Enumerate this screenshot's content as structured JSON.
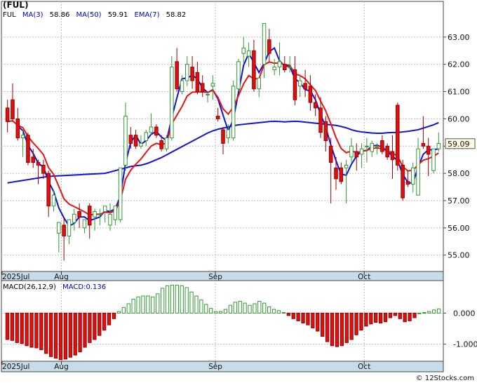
{
  "chart_data": [
    {
      "type": "candlestick",
      "title": "(FUL)",
      "legend": [
        {
          "label": "FUL",
          "color": "#000000"
        },
        {
          "label": "MA(3)",
          "color": "#0000cc"
        },
        {
          "label": "58.86",
          "color": "#000000"
        },
        {
          "label": "MA(50)",
          "color": "#0000cc"
        },
        {
          "label": "59.91",
          "color": "#000000"
        },
        {
          "label": "EMA(7)",
          "color": "#0000cc"
        },
        {
          "label": "58.82",
          "color": "#000000"
        }
      ],
      "last_price_label": "59.09",
      "ylim": [
        54.4,
        64.0
      ],
      "yticks": [
        {
          "v": 55,
          "label": "55.00"
        },
        {
          "v": 56,
          "label": "56.00"
        },
        {
          "v": 57,
          "label": "57.00"
        },
        {
          "v": 58,
          "label": "58.00"
        },
        {
          "v": 59,
          "label": "59.00"
        },
        {
          "v": 60,
          "label": "60.00"
        },
        {
          "v": 61,
          "label": "61.00"
        },
        {
          "v": 62,
          "label": "62.00"
        },
        {
          "v": 63,
          "label": "63.00"
        }
      ],
      "x_labels": [
        {
          "i": 0,
          "label": "2025Jul"
        },
        {
          "i": 11,
          "label": "Aug"
        },
        {
          "i": 41,
          "label": "Sep"
        },
        {
          "i": 70,
          "label": "Oct"
        }
      ],
      "colors": {
        "up_fill": "#ffffff",
        "up_stroke": "#339933",
        "down_fill": "#dd1111",
        "down_stroke": "#990000",
        "ma": "#1111dd",
        "ema": "#ee1111"
      },
      "ohlc": [
        [
          60.4,
          60.7,
          59.5,
          59.9
        ],
        [
          60.7,
          61.3,
          59.9,
          60.0
        ],
        [
          60.0,
          60.4,
          59.2,
          59.3
        ],
        [
          59.3,
          59.6,
          58.6,
          59.4
        ],
        [
          59.4,
          59.5,
          58.3,
          58.4
        ],
        [
          58.6,
          58.9,
          58.2,
          58.4
        ],
        [
          58.4,
          58.5,
          57.6,
          58.3
        ],
        [
          58.3,
          58.5,
          57.8,
          58.0
        ],
        [
          58.0,
          58.1,
          56.4,
          56.8
        ],
        [
          56.8,
          57.4,
          56.6,
          57.2
        ],
        [
          55.8,
          56.1,
          55.1,
          56.2
        ],
        [
          56.1,
          56.4,
          54.8,
          55.7
        ],
        [
          55.7,
          56.2,
          55.4,
          56.3
        ],
        [
          56.2,
          56.7,
          55.9,
          56.5
        ],
        [
          56.6,
          56.9,
          56.0,
          56.4
        ],
        [
          56.0,
          56.3,
          55.8,
          56.3
        ],
        [
          56.8,
          56.9,
          55.6,
          56.1
        ],
        [
          56.4,
          56.7,
          55.9,
          56.6
        ],
        [
          56.5,
          56.7,
          56.1,
          56.5
        ],
        [
          56.6,
          56.7,
          56.2,
          56.8
        ],
        [
          56.1,
          56.9,
          55.9,
          56.5
        ],
        [
          56.3,
          56.8,
          56.1,
          56.8
        ],
        [
          56.3,
          58.1,
          56.2,
          58.2
        ],
        [
          58.3,
          60.6,
          58.1,
          60.1
        ],
        [
          59.4,
          59.7,
          58.9,
          59.1
        ],
        [
          59.4,
          59.6,
          58.9,
          59.0
        ],
        [
          59.0,
          59.4,
          58.9,
          59.1
        ],
        [
          59.2,
          59.6,
          59.0,
          59.5
        ],
        [
          59.5,
          60.2,
          59.4,
          59.7
        ],
        [
          59.7,
          59.8,
          59.3,
          59.4
        ],
        [
          59.2,
          59.4,
          58.8,
          58.9
        ],
        [
          58.9,
          59.4,
          58.8,
          59.3
        ],
        [
          59.3,
          62.3,
          59.2,
          61.9
        ],
        [
          62.1,
          62.6,
          61.0,
          61.1
        ],
        [
          61.0,
          61.6,
          60.9,
          61.4
        ],
        [
          61.4,
          62.3,
          61.2,
          62.0
        ],
        [
          61.9,
          62.3,
          61.1,
          61.4
        ],
        [
          61.7,
          62.1,
          60.9,
          61.0
        ],
        [
          61.3,
          61.6,
          60.8,
          61.0
        ],
        [
          60.9,
          61.0,
          60.6,
          60.9
        ],
        [
          61.2,
          61.6,
          60.7,
          61.3
        ],
        [
          60.1,
          60.4,
          59.9,
          60.0
        ],
        [
          59.6,
          59.7,
          58.7,
          59.1
        ],
        [
          59.3,
          59.8,
          59.1,
          59.6
        ],
        [
          59.3,
          61.4,
          59.2,
          61.2
        ],
        [
          61.1,
          62.2,
          61.0,
          62.1
        ],
        [
          62.4,
          63.0,
          62.0,
          62.6
        ],
        [
          62.3,
          62.8,
          61.9,
          62.5
        ],
        [
          62.5,
          62.9,
          61.0,
          61.1
        ],
        [
          61.1,
          61.4,
          60.8,
          61.5
        ],
        [
          62.0,
          63.3,
          61.5,
          63.5
        ],
        [
          62.9,
          63.3,
          62.1,
          62.4
        ],
        [
          61.8,
          62.2,
          61.6,
          61.9
        ],
        [
          61.9,
          62.8,
          61.6,
          62.1
        ],
        [
          62.0,
          62.3,
          61.7,
          61.8
        ],
        [
          61.9,
          62.3,
          61.7,
          61.9
        ],
        [
          61.8,
          62.3,
          60.5,
          60.7
        ],
        [
          61.2,
          61.6,
          60.8,
          61.4
        ],
        [
          61.3,
          61.8,
          60.8,
          61.1
        ],
        [
          61.2,
          61.6,
          60.3,
          60.6
        ],
        [
          60.6,
          60.9,
          60.1,
          60.4
        ],
        [
          60.4,
          60.8,
          59.3,
          59.5
        ],
        [
          59.9,
          60.1,
          58.8,
          59.2
        ],
        [
          59.0,
          59.3,
          56.9,
          58.4
        ],
        [
          58.2,
          58.6,
          57.4,
          57.8
        ],
        [
          58.2,
          58.4,
          57.6,
          57.7
        ],
        [
          58.2,
          58.5,
          56.9,
          58.3
        ],
        [
          58.6,
          59.3,
          58.4,
          59.0
        ],
        [
          58.8,
          59.1,
          58.1,
          58.6
        ],
        [
          58.7,
          59.1,
          58.2,
          58.9
        ],
        [
          59.0,
          59.3,
          58.4,
          59.0
        ],
        [
          58.8,
          59.2,
          58.6,
          59.1
        ],
        [
          59.0,
          59.1,
          58.7,
          59.0
        ],
        [
          59.2,
          59.4,
          58.7,
          58.8
        ],
        [
          59.0,
          59.1,
          58.5,
          58.6
        ],
        [
          58.8,
          59.4,
          57.8,
          58.5
        ],
        [
          60.5,
          60.6,
          58.1,
          58.3
        ],
        [
          58.3,
          58.5,
          57.0,
          57.1
        ],
        [
          57.7,
          58.1,
          57.5,
          57.6
        ],
        [
          57.6,
          58.4,
          57.3,
          58.2
        ],
        [
          57.2,
          59.3,
          57.2,
          58.9
        ],
        [
          59.1,
          60.1,
          58.9,
          59.0
        ],
        [
          59.0,
          59.3,
          57.9,
          58.7
        ],
        [
          58.1,
          58.8,
          58.0,
          58.9
        ],
        [
          58.9,
          59.5,
          58.8,
          59.1
        ]
      ],
      "ma50": [
        57.65,
        57.68,
        57.71,
        57.74,
        57.77,
        57.8,
        57.83,
        57.86,
        57.88,
        57.9,
        57.91,
        57.92,
        57.93,
        57.94,
        57.95,
        57.96,
        57.97,
        57.98,
        57.99,
        58.0,
        58.05,
        58.1,
        58.15,
        58.2,
        58.25,
        58.28,
        58.3,
        58.35,
        58.42,
        58.5,
        58.58,
        58.68,
        58.78,
        58.88,
        58.98,
        59.08,
        59.18,
        59.28,
        59.38,
        59.48,
        59.56,
        59.62,
        59.66,
        59.7,
        59.75,
        59.78,
        59.8,
        59.82,
        59.84,
        59.86,
        59.88,
        59.9,
        59.91,
        59.9,
        59.89,
        59.9,
        59.91,
        59.9,
        59.88,
        59.86,
        59.84,
        59.82,
        59.8,
        59.78,
        59.76,
        59.72,
        59.67,
        59.6,
        59.55,
        59.52,
        59.5,
        59.48,
        59.47,
        59.47,
        59.49,
        59.5,
        59.5,
        59.52,
        59.54,
        59.57,
        59.6,
        59.66,
        59.72,
        59.78,
        59.86
      ],
      "ema7_last": 58.82,
      "ma3_last": 58.86
    },
    {
      "type": "bar",
      "title": "MACD(26,12,9)",
      "legend": [
        {
          "label": "MACD(26,12,9)",
          "color": "#000000"
        },
        {
          "label": "MACD:0.136",
          "color": "#0000cc"
        }
      ],
      "ylim": [
        -1.55,
        1.0
      ],
      "yticks": [
        {
          "v": 0,
          "label": "0.000"
        },
        {
          "v": -1,
          "label": "-1.000"
        }
      ],
      "values": [
        -0.85,
        -0.88,
        -0.95,
        -0.98,
        -1.05,
        -1.1,
        -1.12,
        -1.18,
        -1.3,
        -1.4,
        -1.45,
        -1.5,
        -1.48,
        -1.42,
        -1.35,
        -1.25,
        -1.1,
        -0.95,
        -0.85,
        -0.72,
        -0.55,
        -0.38,
        -0.18,
        0.05,
        0.18,
        0.3,
        0.45,
        0.52,
        0.55,
        0.55,
        0.52,
        0.62,
        0.8,
        0.88,
        0.9,
        0.9,
        0.88,
        0.82,
        0.68,
        0.55,
        0.42,
        0.28,
        0.15,
        0.05,
        0.05,
        0.12,
        0.25,
        0.35,
        0.38,
        0.32,
        0.25,
        0.3,
        0.38,
        0.32,
        0.2,
        0.12,
        0.08,
        0.02,
        -0.08,
        -0.18,
        -0.25,
        -0.32,
        -0.38,
        -0.48,
        -0.58,
        -0.75,
        -0.92,
        -1.05,
        -1.08,
        -1.05,
        -0.95,
        -0.85,
        -0.7,
        -0.55,
        -0.42,
        -0.35,
        -0.3,
        -0.32,
        -0.28,
        -0.15,
        -0.08,
        -0.18,
        -0.28,
        -0.25,
        -0.15,
        0.0,
        0.02,
        0.05,
        0.1,
        0.136
      ]
    }
  ],
  "footer": {
    "credit": "© 12Stocks.com"
  }
}
